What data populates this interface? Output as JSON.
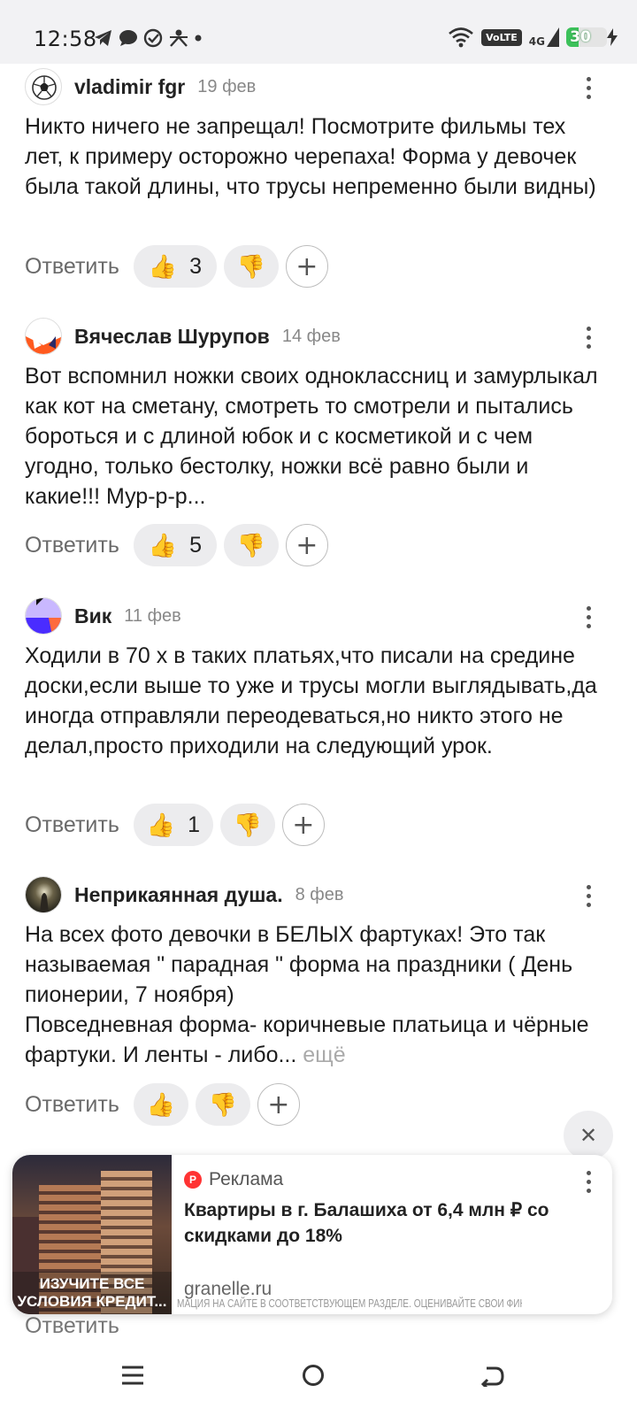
{
  "status_bar": {
    "time": "12:58",
    "volte": "VoLTE",
    "network": "4G",
    "battery": "30",
    "battery_fraction": 0.3
  },
  "comments": [
    {
      "author": "vladimir fgr",
      "date": "19 фев",
      "avatar_icon": "soccer-ball-icon",
      "text": "Никто ничего не запрещал! Посмотрите фильмы тех лет, к примеру осторожно черепаха! Форма у девочек была такой длины, что трусы непременно были видны)",
      "likes": "3",
      "more": ""
    },
    {
      "author": "Вячеслав Шурупов",
      "date": "14 фев",
      "avatar_icon": "abstract-avatar-icon",
      "text": "Вот вспомнил ножки своих одноклассниц и замурлыкал как кот на сметану, смотреть то смотрели и пытались бороться и с длиной юбок и с косметикой и с чем угодно, только бестолку, ножки всё равно были и какие!!! Мур-р-р...",
      "likes": "5",
      "more": ""
    },
    {
      "author": "Вик",
      "date": "11 фев",
      "avatar_icon": "abstract-avatar-icon",
      "text": "Ходили в 70 х в таких платьях,что писали на средине доски,если выше то уже и трусы могли выглядывать,да иногда отправляли переодеваться,но никто этого не делал,просто приходили на следующий урок.",
      "likes": "1",
      "more": ""
    },
    {
      "author": "Неприкаянная душа.",
      "date": "8 фев",
      "avatar_icon": "photo-avatar-icon",
      "text": "На всех фото девочки в БЕЛЫХ фартуках! Это так называемая \" парадная \" форма на праздники ( День пионерии, 7 ноября)\nПовседневная форма- коричневые платьица и чёрные фартуки. И ленты - либо...",
      "likes": "",
      "more": "ещё"
    }
  ],
  "actions": {
    "reply_label": "Ответить",
    "like_emoji": "👍",
    "dislike_emoji": "👎",
    "add_symbol": "+"
  },
  "ad": {
    "label": "Реклама",
    "logo": "P",
    "title": "Квартиры в г. Балашиха от 6,4 млн ₽ со скидками до 18%",
    "domain": "granelle.ru",
    "image_caption_1": "ИЗУЧИТЕ ВСЕ",
    "image_caption_2": "УСЛОВИЯ КРЕДИТ...",
    "disclaimer": "МАЦИЯ НА САЙТЕ В СООТВЕТСТВУЮЩЕМ РАЗДЕЛЕ. ОЦЕНИВАЙТЕ СВОИ ФИНАНСОВЫЕ ВОЗМОЖНОСТИ И РИСКИ",
    "close_symbol": "✕"
  },
  "colors": {
    "status_bg": "#f2f2f4",
    "pill_bg": "#ececee",
    "ad_logo": "#ff3333",
    "battery_green": "#3cc15a"
  }
}
